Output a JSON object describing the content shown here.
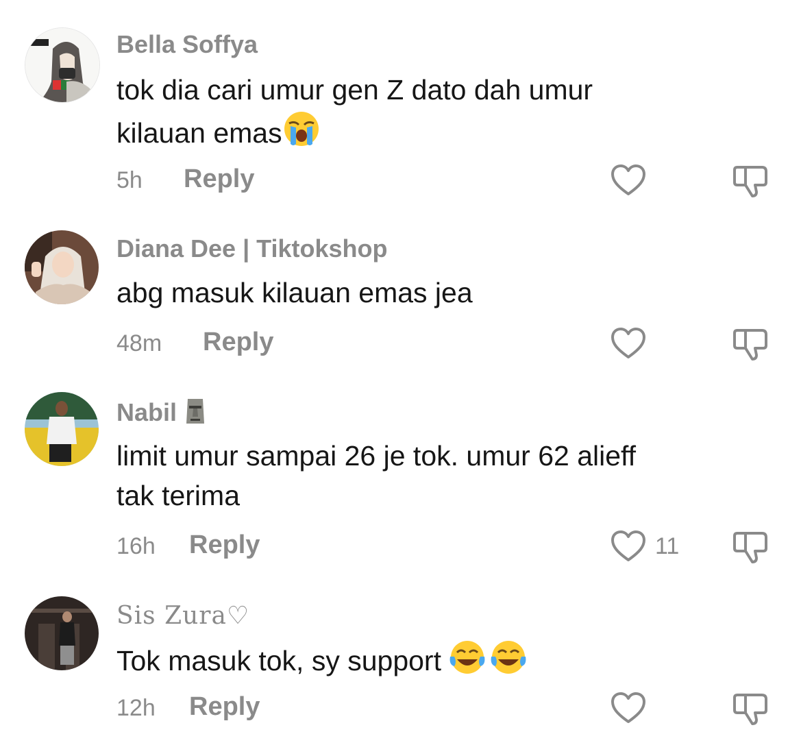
{
  "comments": [
    {
      "username": "Bella Soffya",
      "text_line1": "tok dia cari umur gen Z dato dah umur",
      "text_line2": "kilauan emas",
      "emoji_name": "loudly-crying-face-emoji",
      "time": "5h",
      "reply_label": "Reply"
    },
    {
      "username": "Diana Dee | Tiktokshop",
      "text": "abg masuk kilauan emas jea",
      "time": "48m",
      "reply_label": "Reply"
    },
    {
      "username": "Nabil",
      "username_emoji": "moai-emoji",
      "text_line1": "limit umur sampai 26 je tok. umur 62 alieff",
      "text_line2": "tak terima",
      "time": "16h",
      "reply_label": "Reply",
      "like_count": "11"
    },
    {
      "username": "Sis Zura♡",
      "text": "Tok masuk tok, sy support",
      "emoji_name": "face-with-tears-of-joy-emoji",
      "time": "12h",
      "reply_label": "Reply"
    }
  ],
  "colors": {
    "text": "#161616",
    "muted": "#8a8a8a",
    "background": "#ffffff"
  },
  "icons": [
    "heart-outline-icon",
    "dislike-icon"
  ]
}
